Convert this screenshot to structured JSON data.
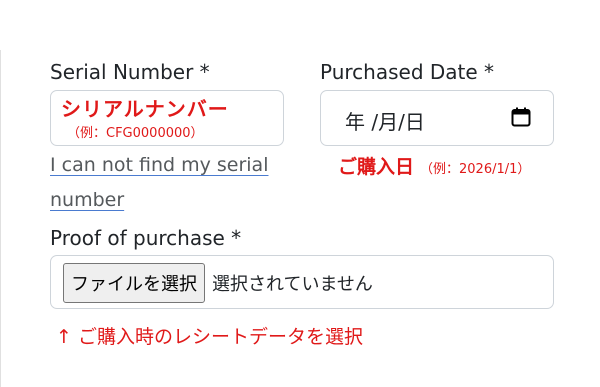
{
  "serial": {
    "label": "Serial Number *",
    "placeholder_main": "シリアルナンバー",
    "placeholder_example": "（例：CFG0000000）",
    "help_link_line1": "I can not find my serial",
    "help_link_line2": "number"
  },
  "purchase_date": {
    "label": "Purchased Date *",
    "value_display": "年 /月/日",
    "hint_main": "ご購入日",
    "hint_example": "（例：2026/1/1）"
  },
  "proof": {
    "label": "Proof of purchase *",
    "button_label": "ファイルを選択",
    "status_text": "選択されていません",
    "note": "↑ ご購入時のレシートデータを選択"
  },
  "colors": {
    "accent_red": "#e01919",
    "link_underline": "#4a7bd0"
  },
  "icons": {
    "date_picker": "calendar-icon"
  }
}
